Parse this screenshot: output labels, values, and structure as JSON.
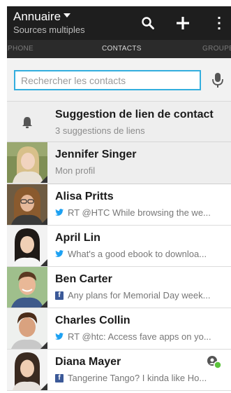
{
  "actionbar": {
    "title": "Annuaire",
    "subtitle": "Sources multiples",
    "icons": [
      "search-icon",
      "add-icon",
      "overflow-menu-icon"
    ]
  },
  "tabs": [
    {
      "label": "ÉPHONE"
    },
    {
      "label": "CONTACTS"
    },
    {
      "label": "GROUPE"
    }
  ],
  "search": {
    "placeholder": "Rechercher les contacts",
    "value": ""
  },
  "suggestion": {
    "title": "Suggestion de lien de contact",
    "subtitle": "3 suggestions de liens"
  },
  "profile": {
    "name": "Jennifer Singer",
    "subtitle": "Mon profil"
  },
  "contacts": [
    {
      "name": "Alisa Pritts",
      "service": "twitter",
      "status": "RT @HTC While browsing the we..."
    },
    {
      "name": "April Lin",
      "service": "twitter",
      "status": "What's a good ebook to downloa..."
    },
    {
      "name": "Ben Carter",
      "service": "facebook",
      "status": "Any plans for Memorial Day week..."
    },
    {
      "name": "Charles Collin",
      "service": "twitter",
      "status": "RT @htc: Access fave apps on yo..."
    },
    {
      "name": "Diana Mayer",
      "service": "facebook",
      "status": "Tangerine Tango? I kinda like Ho..."
    }
  ],
  "colors": {
    "actionbar": "#1e1e1e",
    "accent": "#33aede",
    "twitter": "#1da1f2",
    "facebook": "#3b5998",
    "online": "#5cc33c"
  }
}
